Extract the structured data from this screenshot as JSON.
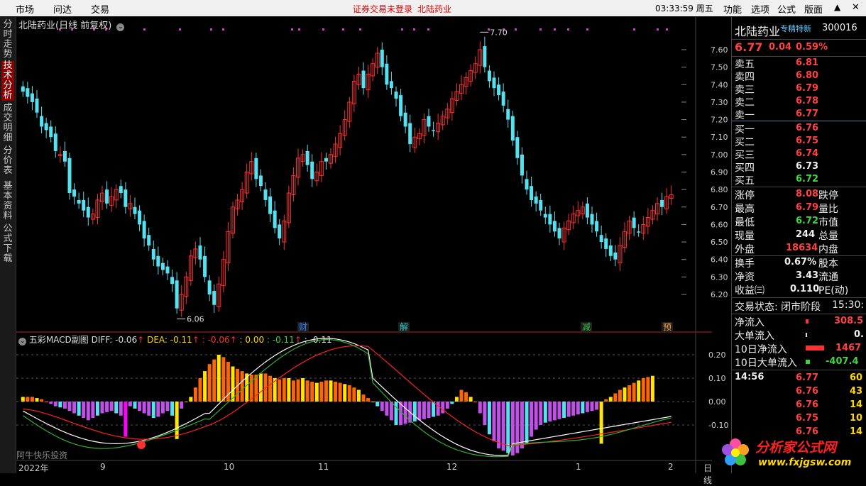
{
  "menu": {
    "market": "市场",
    "wenda": "问达",
    "trade": "交易",
    "alert": "证券交易未登录",
    "stock_alert": "北陆药业",
    "time": "03:33:59 周五",
    "func": "功能",
    "options": "选项",
    "formula": "公式",
    "layout": "版面"
  },
  "left_tabs": [
    "分时走势",
    "技术分析",
    "成交明细",
    "分价表",
    "基本资料",
    "公式下载"
  ],
  "chart": {
    "title": "北陆药业(日线 前复权)",
    "high_label": "7.70",
    "low_label": "6.06",
    "events": [
      "财",
      "解",
      "减",
      "预"
    ],
    "price_ticks": [
      "7.60",
      "7.50",
      "7.40",
      "7.30",
      "7.20",
      "7.10",
      "7.00",
      "6.90",
      "6.80",
      "6.70",
      "6.60",
      "6.50",
      "6.40",
      "6.30",
      "6.20"
    ],
    "macd_ticks": [
      "0.20",
      "0.10",
      "0.00",
      "-0.10"
    ],
    "macd_title": "五彩MACD副图",
    "diff": "DIFF: -0.06",
    "dea": "DEA: -0.11",
    "v1": ": -0.06",
    "v2": ": 0.00",
    "v3": ": -0.11",
    "v4": ": -0.11",
    "watermark_left": "阿牛快乐投资",
    "dates": [
      "2022年",
      "9",
      "10",
      "11",
      "12",
      "1",
      "2"
    ],
    "period": "日线",
    "colors": {
      "up": "#ff3030",
      "down": "#54e1f0",
      "macd_pos_a": "#ff6600",
      "macd_pos_b": "#ffe600",
      "macd_neg_a": "#c050e8",
      "macd_neg_b": "#54e1f0"
    }
  },
  "quote": {
    "name": "北陆药业",
    "tag": "专精特新",
    "code": "300016",
    "price": "6.77",
    "change": "0.04",
    "pct": "0.59%",
    "asks": [
      {
        "l": "卖五",
        "p": "6.81"
      },
      {
        "l": "卖四",
        "p": "6.80"
      },
      {
        "l": "卖三",
        "p": "6.79"
      },
      {
        "l": "卖二",
        "p": "6.78"
      },
      {
        "l": "卖一",
        "p": "6.77"
      }
    ],
    "bids": [
      {
        "l": "买一",
        "p": "6.76"
      },
      {
        "l": "买二",
        "p": "6.75"
      },
      {
        "l": "买三",
        "p": "6.74"
      },
      {
        "l": "买四",
        "p": "6.73"
      },
      {
        "l": "买五",
        "p": "6.72"
      }
    ],
    "stats": [
      {
        "l": "涨停",
        "v": "8.08",
        "r": "跌停"
      },
      {
        "l": "最高",
        "v": "6.79",
        "r": "量比"
      },
      {
        "l": "最低",
        "v": "6.72",
        "r": "市值"
      },
      {
        "l": "现量",
        "v": "244",
        "r": "总量"
      },
      {
        "l": "外盘",
        "v": "18634",
        "r": "内盘"
      }
    ],
    "stats2": [
      {
        "l": "换手",
        "v": "0.67%",
        "r": "股本"
      },
      {
        "l": "净资",
        "v": "3.43",
        "r": "流通"
      },
      {
        "l": "收益㈢",
        "v": "0.110",
        "r": "PE(动)"
      }
    ],
    "state": "交易状态: 闭市阶段",
    "state_time": "15:30:",
    "flows": [
      {
        "l": "净流入",
        "v": "308.5"
      },
      {
        "l": "大单流入",
        "v": "0."
      },
      {
        "l": "10日净流入",
        "v": "1467"
      },
      {
        "l": "10日大单流入",
        "v": "-407.4"
      }
    ],
    "ticks_time": "14:56",
    "ticks": [
      {
        "p": "6.77",
        "v": "60"
      },
      {
        "p": "6.76",
        "v": "43"
      },
      {
        "p": "6.76",
        "v": "14"
      },
      {
        "p": "6.75",
        "v": "10"
      },
      {
        "p": "6.76",
        "v": "14"
      }
    ]
  },
  "site": {
    "name": "分析家公式网",
    "url": "www.fxjgsw.com"
  }
}
